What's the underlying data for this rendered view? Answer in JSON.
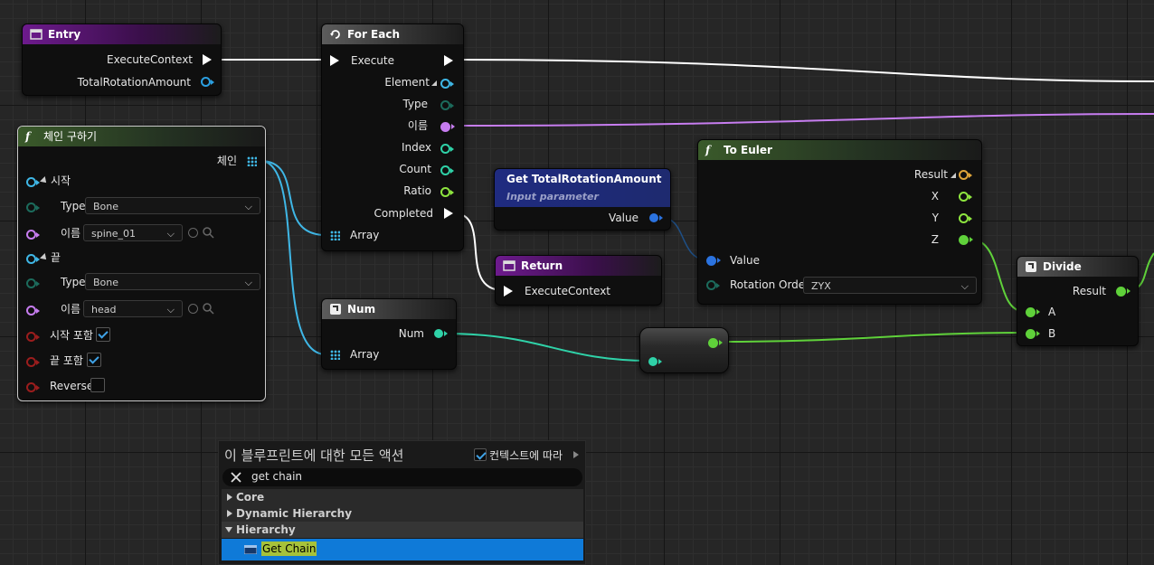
{
  "nodes": {
    "entry": {
      "title": "Entry",
      "pins": {
        "execute_context": "ExecuteContext",
        "total_rotation_amount": "TotalRotationAmount"
      }
    },
    "for_each": {
      "title": "For Each",
      "pins": {
        "execute": "Execute",
        "element": "Element",
        "type": "Type",
        "name": "이름",
        "index": "Index",
        "count": "Count",
        "ratio": "Ratio",
        "completed": "Completed",
        "array": "Array"
      }
    },
    "get_chain": {
      "title": "체인 구하기",
      "pins": {
        "chain": "체인",
        "start": "시작",
        "end": "끝",
        "start_type_label": "Type",
        "start_name_label": "이름",
        "end_type_label": "Type",
        "end_name_label": "이름",
        "include_start": "시작 포함",
        "include_end": "끝 포함",
        "reverse": "Reverse"
      },
      "values": {
        "start_type": "Bone",
        "start_name": "spine_01",
        "end_type": "Bone",
        "end_name": "head",
        "include_start": true,
        "include_end": true,
        "reverse": false
      }
    },
    "get_param": {
      "title": "Get TotalRotationAmount",
      "subtitle": "Input parameter",
      "pins": {
        "value": "Value"
      }
    },
    "to_euler": {
      "title": "To Euler",
      "pins": {
        "result": "Result",
        "x": "X",
        "y": "Y",
        "z": "Z",
        "value": "Value",
        "rotation_order": "Rotation Order"
      },
      "values": {
        "rotation_order": "ZYX"
      }
    },
    "return": {
      "title": "Return",
      "pins": {
        "execute_context": "ExecuteContext"
      }
    },
    "num": {
      "title": "Num",
      "pins": {
        "num": "Num",
        "array": "Array"
      }
    },
    "divide": {
      "title": "Divide",
      "pins": {
        "result": "Result",
        "a": "A",
        "b": "B"
      }
    }
  },
  "palette": {
    "title": "이 블루프린트에 대한 모든 액션",
    "context_label": "컨텍스트에 따라",
    "context_checked": true,
    "search_value": "get chain",
    "categories": [
      {
        "label": "Core",
        "expanded": false
      },
      {
        "label": "Dynamic Hierarchy",
        "expanded": false
      },
      {
        "label": "Hierarchy",
        "expanded": true
      }
    ],
    "selected_item": "Get Chain"
  },
  "colors": {
    "exec": "#ffffff",
    "name_pin": "#c77df0",
    "int_pin": "#2fd2a8",
    "float_pin": "#8ee63f",
    "struct_pin": "#2b9fe0",
    "bool_pin": "#9b1d1d",
    "selection": "#0f7ad8"
  }
}
